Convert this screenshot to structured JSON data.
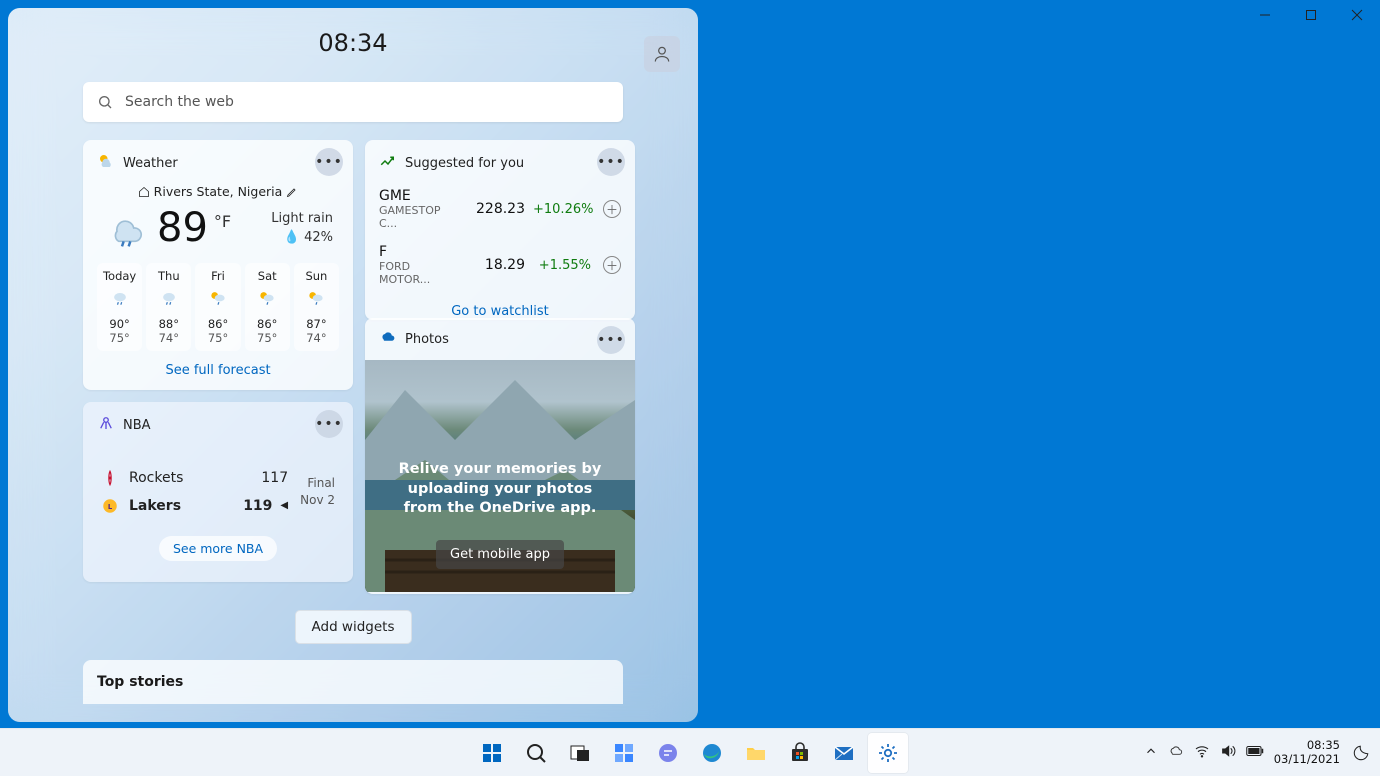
{
  "panel": {
    "time": "08:34",
    "search_placeholder": "Search the web"
  },
  "weather": {
    "title": "Weather",
    "location": "Rivers State, Nigeria",
    "temp": "89",
    "unit": "°F",
    "condition": "Light rain",
    "precip": "42%",
    "days": [
      {
        "label": "Today",
        "hi": "90°",
        "lo": "75°"
      },
      {
        "label": "Thu",
        "hi": "88°",
        "lo": "74°"
      },
      {
        "label": "Fri",
        "hi": "86°",
        "lo": "75°"
      },
      {
        "label": "Sat",
        "hi": "86°",
        "lo": "75°"
      },
      {
        "label": "Sun",
        "hi": "87°",
        "lo": "74°"
      }
    ],
    "link": "See full forecast"
  },
  "stocks": {
    "title": "Suggested for you",
    "rows": [
      {
        "sym": "GME",
        "name": "GAMESTOP C...",
        "price": "228.23",
        "chg": "+10.26%"
      },
      {
        "sym": "F",
        "name": "FORD MOTOR...",
        "price": "18.29",
        "chg": "+1.55%"
      }
    ],
    "link": "Go to watchlist"
  },
  "nba": {
    "title": "NBA",
    "team1": "Rockets",
    "score1": "117",
    "team2": "Lakers",
    "score2": "119",
    "status": "Final",
    "date": "Nov 2",
    "link": "See more NBA"
  },
  "photos": {
    "title": "Photos",
    "hero_text": "Relive your memories by uploading your photos from the OneDrive app.",
    "cta": "Get mobile app"
  },
  "add_widgets": "Add widgets",
  "top_stories": "Top stories",
  "tray": {
    "time": "08:35",
    "date": "03/11/2021"
  }
}
